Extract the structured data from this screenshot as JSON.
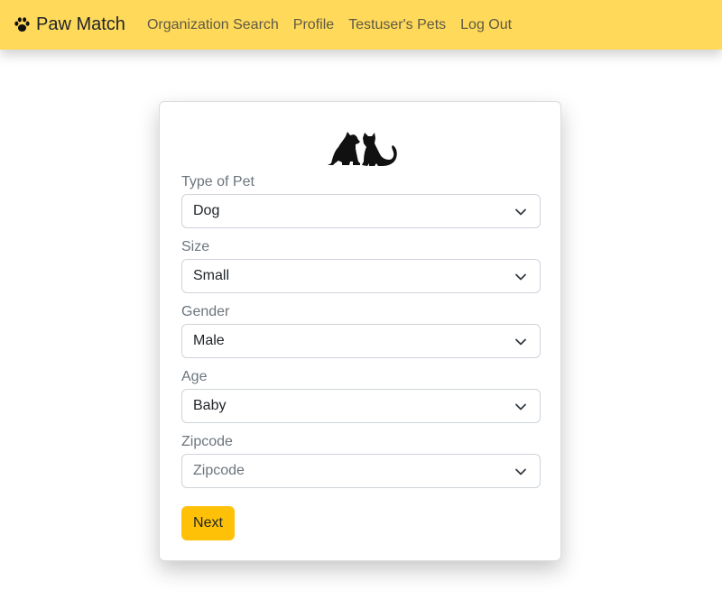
{
  "navbar": {
    "brand": "Paw Match",
    "brand_icon": "paw-icon",
    "links": [
      "Organization Search",
      "Profile",
      "Testuser's Pets",
      "Log Out"
    ]
  },
  "form": {
    "logo_icon": "dog-and-cat-silhouette-icon",
    "fields": [
      {
        "label": "Type of Pet",
        "value": "Dog"
      },
      {
        "label": "Size",
        "value": "Small"
      },
      {
        "label": "Gender",
        "value": "Male"
      },
      {
        "label": "Age",
        "value": "Baby"
      },
      {
        "label": "Zipcode",
        "value": "Zipcode"
      }
    ],
    "next_label": "Next"
  },
  "colors": {
    "navbar_bg": "#ffd95a",
    "button_bg": "#ffc107"
  }
}
